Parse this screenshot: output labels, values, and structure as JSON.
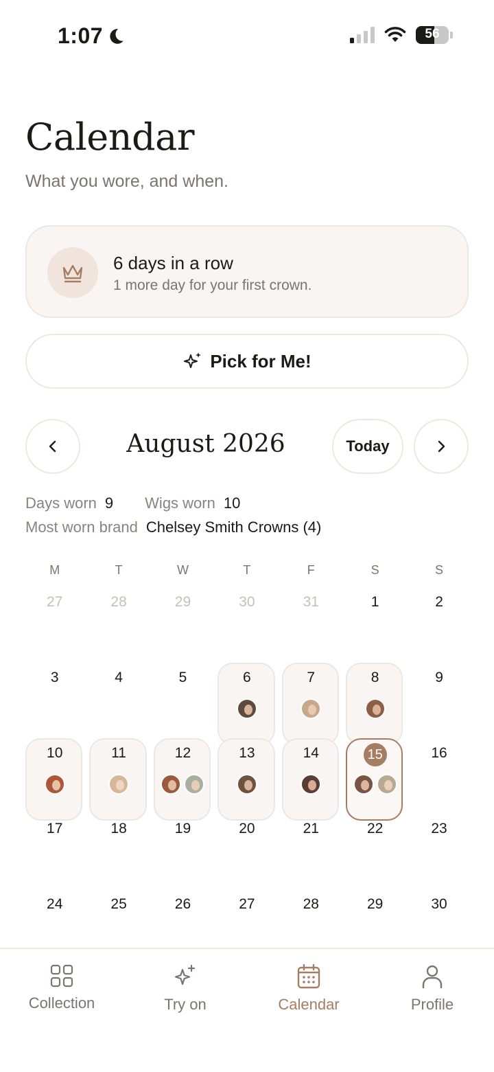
{
  "status_bar": {
    "time": "1:07",
    "battery": "56"
  },
  "header": {
    "title": "Calendar",
    "subtitle": "What you wore, and when."
  },
  "streak": {
    "title": "6 days in a row",
    "subtitle": "1 more day for your first crown."
  },
  "pick_button": {
    "label": "Pick for Me!"
  },
  "month_nav": {
    "month": "August 2026",
    "today_label": "Today"
  },
  "stats": {
    "days_worn_label": "Days worn",
    "days_worn": "9",
    "wigs_worn_label": "Wigs worn",
    "wigs_worn": "10",
    "most_worn_label": "Most worn brand",
    "most_worn_brand": "Chelsey Smith Crowns (4)"
  },
  "weekdays": [
    "M",
    "T",
    "W",
    "T",
    "F",
    "S",
    "S"
  ],
  "calendar_days": [
    {
      "day": "27",
      "muted": true
    },
    {
      "day": "28",
      "muted": true
    },
    {
      "day": "29",
      "muted": true
    },
    {
      "day": "30",
      "muted": true
    },
    {
      "day": "31",
      "muted": true
    },
    {
      "day": "1"
    },
    {
      "day": "2"
    },
    {
      "day": "3"
    },
    {
      "day": "4"
    },
    {
      "day": "5"
    },
    {
      "day": "6",
      "avatars": [
        {
          "hair": "#5e4a3e",
          "skin": "#d9b49c"
        }
      ]
    },
    {
      "day": "7",
      "avatars": [
        {
          "hair": "#c9a88a",
          "skin": "#e8c9b2"
        }
      ]
    },
    {
      "day": "8",
      "avatars": [
        {
          "hair": "#8a5f45",
          "skin": "#dcb39a"
        }
      ]
    },
    {
      "day": "9"
    },
    {
      "day": "10",
      "avatars": [
        {
          "hair": "#b0553a",
          "skin": "#e6c2a8"
        }
      ]
    },
    {
      "day": "11",
      "avatars": [
        {
          "hair": "#d6b79a",
          "skin": "#efd6c3"
        }
      ]
    },
    {
      "day": "12",
      "avatars": [
        {
          "hair": "#9a5a3c",
          "skin": "#e2bda2"
        },
        {
          "hair": "#a8b0a0",
          "skin": "#e9cdb8"
        }
      ]
    },
    {
      "day": "13",
      "avatars": [
        {
          "hair": "#6e5240",
          "skin": "#dcb59c"
        }
      ]
    },
    {
      "day": "14",
      "avatars": [
        {
          "hair": "#5a3e34",
          "skin": "#d7ad94"
        }
      ]
    },
    {
      "day": "15",
      "today": true,
      "avatars": [
        {
          "hair": "#7a5444",
          "skin": "#deb79e"
        },
        {
          "hair": "#b8aa92",
          "skin": "#ebcfba"
        }
      ]
    },
    {
      "day": "16"
    },
    {
      "day": "17"
    },
    {
      "day": "18"
    },
    {
      "day": "19"
    },
    {
      "day": "20"
    },
    {
      "day": "21"
    },
    {
      "day": "22"
    },
    {
      "day": "23"
    },
    {
      "day": "24"
    },
    {
      "day": "25"
    },
    {
      "day": "26"
    },
    {
      "day": "27"
    },
    {
      "day": "28"
    },
    {
      "day": "29"
    },
    {
      "day": "30"
    }
  ],
  "tabs": [
    {
      "label": "Collection",
      "icon": "grid-icon"
    },
    {
      "label": "Try on",
      "icon": "sparkle-icon"
    },
    {
      "label": "Calendar",
      "icon": "calendar-icon",
      "active": true
    },
    {
      "label": "Profile",
      "icon": "person-icon"
    }
  ],
  "colors": {
    "accent": "#a67c62",
    "card_bg": "#f8f5f2",
    "border": "#ece7e2",
    "muted_text": "#7b7570"
  }
}
